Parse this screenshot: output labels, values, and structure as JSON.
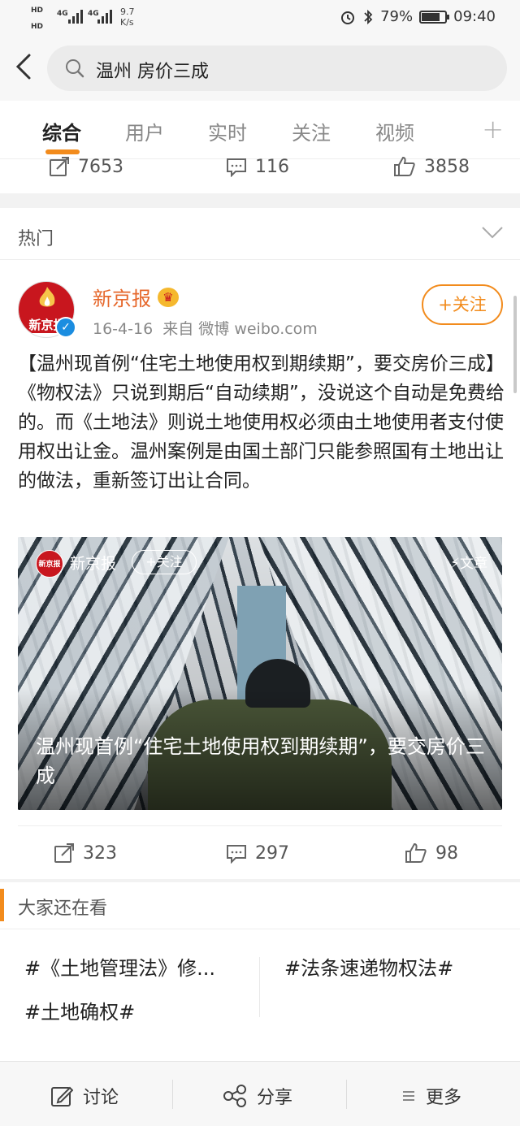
{
  "status_bar": {
    "hd1": "HD",
    "hd2": "HD",
    "net1": "4G",
    "net2": "4G",
    "speed_value": "9.7",
    "speed_unit": "K/s",
    "battery": "79%",
    "battery_level": 0.79,
    "time": "09:40"
  },
  "search": {
    "query": "温州 房价三成"
  },
  "tabs": [
    {
      "label": "综合",
      "active": true
    },
    {
      "label": "用户"
    },
    {
      "label": "实时"
    },
    {
      "label": "关注"
    },
    {
      "label": "视频"
    }
  ],
  "prev_post_stats": {
    "reposts": "7653",
    "comments": "116",
    "likes": "3858"
  },
  "hot_section": {
    "title": "热门"
  },
  "post": {
    "author": "新京报",
    "avatar_text": "新京报",
    "date": "16-4-16",
    "source": "来自 微博 weibo.com",
    "follow_label": "+关注",
    "text": "【温州现首例“住宅土地使用权到期续期”，要交房价三成】《物权法》只说到期后“自动续期”，没说这个自动是免费给的。而《土地法》则说土地使用权必须由土地使用者支付使用权出让金。温州案例是由国土部门只能参照国有土地出让的做法，重新签订出让合同。",
    "article": {
      "author": "新京报",
      "follow_label": "+关注",
      "tag": "文章",
      "title": "温州现首例“住宅土地使用权到期续期”，要交房价三成"
    },
    "stats": {
      "reposts": "323",
      "comments": "297",
      "likes": "98"
    }
  },
  "see_also": {
    "title": "大家还在看",
    "topics": [
      "#《土地管理法》修...",
      "#法条速递物权法#",
      "#土地确权#"
    ]
  },
  "bottom_bar": {
    "discuss": "讨论",
    "share": "分享",
    "more": "更多"
  },
  "colors": {
    "accent": "#f28b1c",
    "author": "#e6682c",
    "verified": "#1b8de0"
  }
}
